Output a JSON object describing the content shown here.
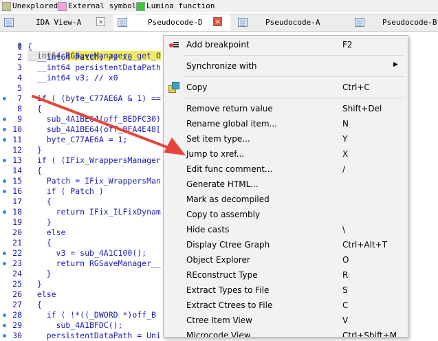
{
  "legend": [
    {
      "label": "Unexplored",
      "color": "#c8c886"
    },
    {
      "label": "External symbol",
      "color": "#ff9ee8"
    },
    {
      "label": "Lumina function",
      "color": "#33cc33"
    }
  ],
  "tabs": [
    {
      "label": "IDA View-A",
      "active": false,
      "close": "×"
    },
    {
      "label": "Pseudocode-D",
      "active": true,
      "close": "×"
    },
    {
      "label": "Pseudocode-A",
      "active": false
    },
    {
      "label": "Pseudocode-B",
      "active": false
    }
  ],
  "code": {
    "signature_prefix": "__int64 ",
    "signature_name": "RGSaveManager__get_O",
    "lines": [
      {
        "n": "1",
        "dot": false,
        "text": "{"
      },
      {
        "n": "2",
        "dot": false,
        "text": "  __int64 Patch; // x0"
      },
      {
        "n": "3",
        "dot": false,
        "text": "  __int64 persistentDataPath"
      },
      {
        "n": "4",
        "dot": false,
        "text": "  __int64 v3; // x0"
      },
      {
        "n": "5",
        "dot": false,
        "text": ""
      },
      {
        "n": "7",
        "dot": true,
        "text": "  if ( (byte_C77AE6A & 1) =="
      },
      {
        "n": "8",
        "dot": false,
        "text": "  {"
      },
      {
        "n": "9",
        "dot": true,
        "text": "    sub_4A1BE64(off_BEDFC30)"
      },
      {
        "n": "10",
        "dot": true,
        "text": "    sub_4A1BE64(off_BFA4E48["
      },
      {
        "n": "11",
        "dot": true,
        "text": "    byte_C77AE6A = 1;"
      },
      {
        "n": "12",
        "dot": false,
        "text": "  }"
      },
      {
        "n": "13",
        "dot": true,
        "text": "  if ( (IFix_WrappersManager"
      },
      {
        "n": "14",
        "dot": false,
        "text": "  {"
      },
      {
        "n": "15",
        "dot": true,
        "text": "    Patch = IFix_WrappersMan"
      },
      {
        "n": "16",
        "dot": true,
        "text": "    if ( Patch )"
      },
      {
        "n": "17",
        "dot": false,
        "text": "    {"
      },
      {
        "n": "18",
        "dot": true,
        "text": "      return IFix_ILFixDynam"
      },
      {
        "n": "19",
        "dot": false,
        "text": "    }"
      },
      {
        "n": "20",
        "dot": false,
        "text": "    else"
      },
      {
        "n": "21",
        "dot": false,
        "text": "    {"
      },
      {
        "n": "22",
        "dot": true,
        "text": "      v3 = sub_4A1C100();"
      },
      {
        "n": "23",
        "dot": true,
        "text": "      return RGSaveManager__"
      },
      {
        "n": "24",
        "dot": false,
        "text": "    }"
      },
      {
        "n": "25",
        "dot": false,
        "text": "  }"
      },
      {
        "n": "26",
        "dot": false,
        "text": "  else"
      },
      {
        "n": "27",
        "dot": false,
        "text": "  {"
      },
      {
        "n": "28",
        "dot": true,
        "text": "    if ( !*((_DWORD *)off_B"
      },
      {
        "n": "29",
        "dot": true,
        "text": "      sub_4A1BFDC();"
      },
      {
        "n": "30",
        "dot": true,
        "text": "    persistentDataPath = Uni"
      }
    ]
  },
  "context_menu": {
    "items": [
      {
        "label": "Add breakpoint",
        "shortcut": "F2",
        "icon": "breakpoint-icon"
      },
      {
        "label": "Synchronize with",
        "shortcut": "",
        "submenu": true
      },
      {
        "label": "Copy",
        "shortcut": "Ctrl+C",
        "icon": "copy-icon"
      },
      {
        "label": "Remove return value",
        "shortcut": "Shift+Del"
      },
      {
        "label": "Rename global item...",
        "shortcut": "N"
      },
      {
        "label": "Set item type...",
        "shortcut": "Y"
      },
      {
        "label": "Jump to xref...",
        "shortcut": "X"
      },
      {
        "label": "Edit func comment...",
        "shortcut": "/"
      },
      {
        "label": "Generate HTML...",
        "shortcut": ""
      },
      {
        "label": "Mark as decompiled",
        "shortcut": ""
      },
      {
        "label": "Copy to assembly",
        "shortcut": ""
      },
      {
        "label": "Hide casts",
        "shortcut": "\\"
      },
      {
        "label": "Display Ctree Graph",
        "shortcut": "Ctrl+Alt+T"
      },
      {
        "label": "Object Explorer",
        "shortcut": "O"
      },
      {
        "label": "REconstruct Type",
        "shortcut": "R"
      },
      {
        "label": "Extract Types to File",
        "shortcut": "S"
      },
      {
        "label": "Extract Ctrees to File",
        "shortcut": "C"
      },
      {
        "label": "Ctree Item View",
        "shortcut": "V"
      },
      {
        "label": "Microcode View",
        "shortcut": "Ctrl+Shift+M"
      }
    ],
    "submenu_arrow": "▶"
  },
  "annotation": {
    "arrow_color": "#e8453c"
  }
}
